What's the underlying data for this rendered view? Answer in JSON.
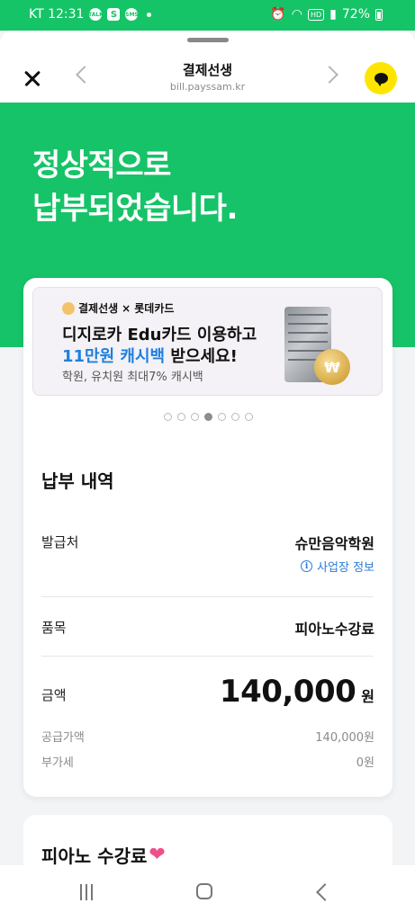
{
  "status_bar": {
    "carrier_time": "KT 12:31",
    "talk_icon_label": "TALK",
    "s_icon_label": "S",
    "sms_icon_label": "SMS",
    "hd_label": "HD",
    "battery": "72%"
  },
  "sheet": {
    "title": "결제선생",
    "url": "bill.payssam.kr"
  },
  "hero": {
    "line1": "정상적으로",
    "line2": "납부되었습니다."
  },
  "banner": {
    "brand1": "결제선생",
    "brand_x": "×",
    "brand2": "롯데카드",
    "line1": "디지로카 Edu카드 이용하고",
    "highlight": "11만원 캐시백",
    "line2_rest": " 받으세요!",
    "line3": "학원, 유치원 최대7% 캐시백",
    "coin_symbol": "₩"
  },
  "carousel": {
    "count": 7,
    "active_index": 4
  },
  "payment": {
    "section_title": "납부 내역",
    "issuer_label": "발급처",
    "issuer_value": "슈만음악학원",
    "business_info_link": "사업장 정보",
    "info_icon_glyph": "i",
    "item_label": "품목",
    "item_value": "피아노수강료",
    "amount_label": "금액",
    "amount_value": "140,000",
    "amount_unit": "원",
    "supply_label": "공급가액",
    "supply_value": "140,000원",
    "vat_label": "부가세",
    "vat_value": "0원"
  },
  "card2": {
    "title": "피아노 수강료",
    "heart": "❤"
  },
  "colors": {
    "brand_green": "#17c368",
    "link_blue": "#2a7bd8",
    "kakao_yellow": "#fee500"
  }
}
